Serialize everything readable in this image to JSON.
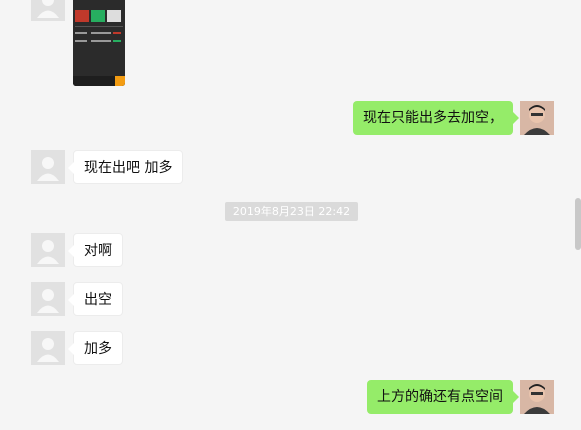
{
  "chat": {
    "messages": [
      {
        "text": "现在只能出多去加空，"
      },
      {
        "text": "现在出吧 加多"
      },
      {
        "text": "对啊"
      },
      {
        "text": "出空"
      },
      {
        "text": "加多"
      },
      {
        "text": "上方的确还有点空间"
      }
    ],
    "timestamp": "2019年8月23日 22:42"
  },
  "colors": {
    "background": "#f5f5f5",
    "incoming_bubble": "#ffffff",
    "outgoing_bubble": "#95ec69",
    "timestamp_bg": "#dadada"
  }
}
